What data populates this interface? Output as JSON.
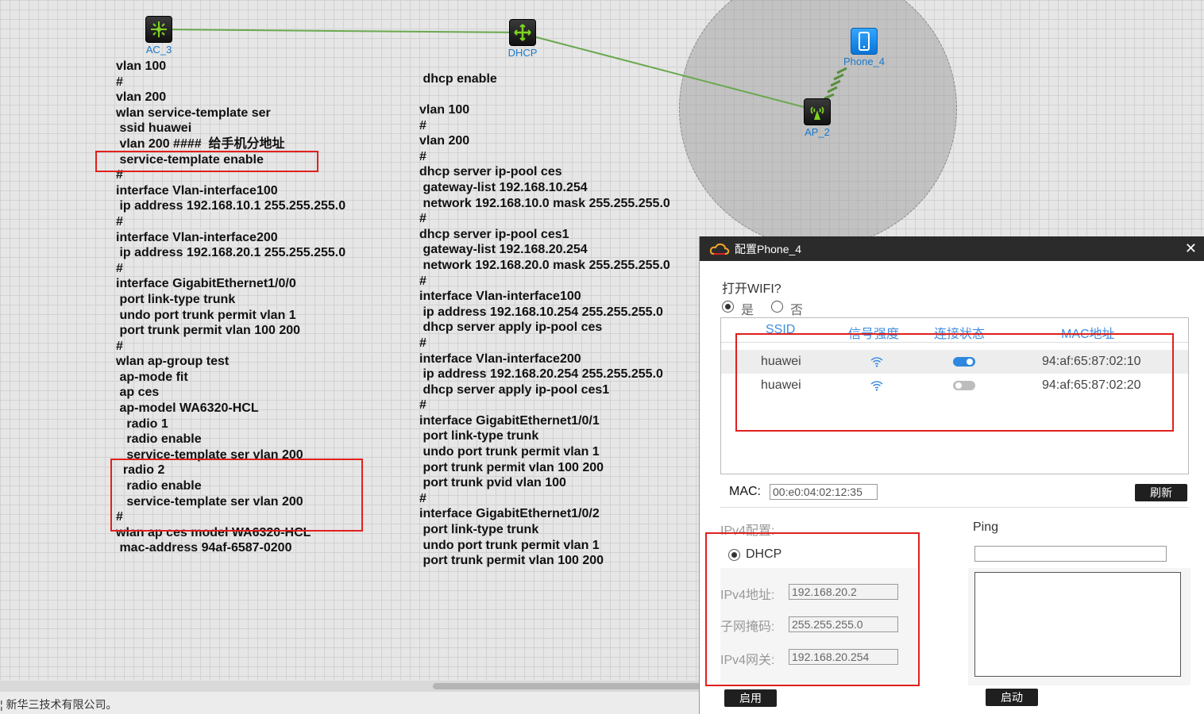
{
  "devices": {
    "ac": {
      "label": "AC_3",
      "icon": "wireless-controller-icon"
    },
    "dhcp": {
      "label": "DHCP",
      "icon": "router-icon"
    },
    "ap": {
      "label": "AP_2",
      "icon": "access-point-icon"
    },
    "phone": {
      "label": "Phone_4",
      "icon": "smartphone-icon"
    }
  },
  "ac_config": [
    "vlan 100",
    "#",
    "vlan 200",
    "wlan service-template ser",
    " ssid huawei",
    " vlan 200 ####  给手机分地址",
    " service-template enable",
    "#",
    "interface Vlan-interface100",
    " ip address 192.168.10.1 255.255.255.0",
    "#",
    "interface Vlan-interface200",
    " ip address 192.168.20.1 255.255.255.0",
    "#",
    "interface GigabitEthernet1/0/0",
    " port link-type trunk",
    " undo port trunk permit vlan 1",
    " port trunk permit vlan 100 200",
    "#",
    "wlan ap-group test",
    " ap-mode fit",
    " ap ces",
    " ap-model WA6320-HCL",
    "   radio 1",
    "   radio enable",
    "   service-template ser vlan 200",
    "  radio 2",
    "   radio enable",
    "   service-template ser vlan 200",
    "#",
    "wlan ap ces model WA6320-HCL",
    " mac-address 94af-6587-0200"
  ],
  "dhcp_config_head": " dhcp enable",
  "dhcp_config": [
    "vlan 100",
    "#",
    "vlan 200",
    "#",
    "dhcp server ip-pool ces",
    " gateway-list 192.168.10.254",
    " network 192.168.10.0 mask 255.255.255.0",
    "#",
    "dhcp server ip-pool ces1",
    " gateway-list 192.168.20.254",
    " network 192.168.20.0 mask 255.255.255.0",
    "#",
    "interface Vlan-interface100",
    " ip address 192.168.10.254 255.255.255.0",
    " dhcp server apply ip-pool ces",
    "#",
    "interface Vlan-interface200",
    " ip address 192.168.20.254 255.255.255.0",
    " dhcp server apply ip-pool ces1",
    "#",
    "interface GigabitEthernet1/0/1",
    " port link-type trunk",
    " undo port trunk permit vlan 1",
    " port trunk permit vlan 100 200",
    " port trunk pvid vlan 100",
    "#",
    "interface GigabitEthernet1/0/2",
    " port link-type trunk",
    " undo port trunk permit vlan 1",
    " port trunk permit vlan 100 200"
  ],
  "footer": "¦ 新华三技术有限公司。",
  "dialog": {
    "title": "配置Phone_4",
    "close": "✕",
    "wifi_question": "打开WIFI?",
    "wifi_yes": "是",
    "wifi_no": "否",
    "wifi_enabled": true,
    "table": {
      "headers": [
        "SSID",
        "信号强度",
        "连接状态",
        "MAC地址"
      ],
      "rows": [
        {
          "ssid": "huawei",
          "signal": "wifi-signal-icon",
          "connected": true,
          "mac": "94:af:65:87:02:10"
        },
        {
          "ssid": "huawei",
          "signal": "wifi-signal-icon",
          "connected": false,
          "mac": "94:af:65:87:02:20"
        }
      ]
    },
    "mac_label": "MAC:",
    "mac_value": "00:e0:04:02:12:35",
    "refresh": "刷新",
    "ipv4_heading": "IPv4配置:",
    "dhcp_label": "DHCP",
    "dhcp_selected": true,
    "ipv4_addr_label": "IPv4地址:",
    "ipv4_addr": "192.168.20.2",
    "mask_label": "子网掩码:",
    "mask": "255.255.255.0",
    "gateway_label": "IPv4网关:",
    "gateway": "192.168.20.254",
    "apply": "启用",
    "ping_heading": "Ping",
    "ping_target": "",
    "ping_output": "",
    "start": "启动"
  },
  "colors": {
    "link": "#6aa84f",
    "highlight": "#e0201e",
    "device_label": "#1a78c9",
    "table_header": "#3f8de0"
  }
}
